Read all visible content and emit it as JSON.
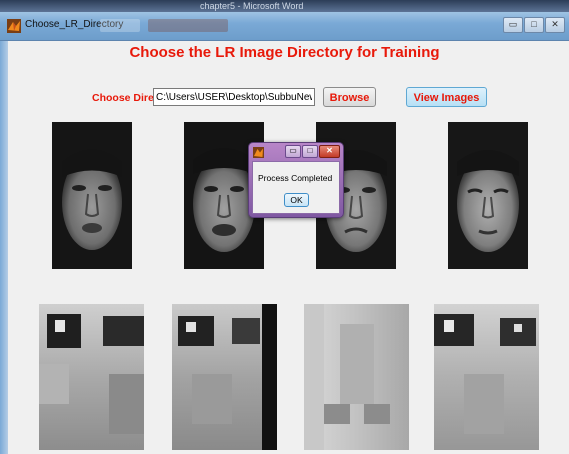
{
  "background_window": {
    "title": "chapter5 - Microsoft Word"
  },
  "window": {
    "title": "Choose_LR_Directory",
    "controls": [
      "minimize-icon",
      "maximize-icon",
      "close-icon"
    ]
  },
  "main": {
    "heading": "Choose the LR Image Directory for Training",
    "directory_label": "Choose Directory",
    "directory_value": "C:\\Users\\USER\\Desktop\\SubbuNewFinal",
    "browse_label": "Browse",
    "view_images_label": "View Images",
    "faces": [
      "face-image-1",
      "face-image-2",
      "face-image-3",
      "face-image-4"
    ],
    "crops": [
      "eye-crop-1",
      "eye-crop-2",
      "nose-crop-3",
      "eye-crop-4"
    ]
  },
  "dialog": {
    "message": "Process Completed",
    "ok_label": "OK"
  },
  "colors": {
    "accent_red": "#e8190a",
    "view_button": "#b7e0f5",
    "dialog_frame": "#7f58a2",
    "titlebar": "#7aa9d6"
  }
}
